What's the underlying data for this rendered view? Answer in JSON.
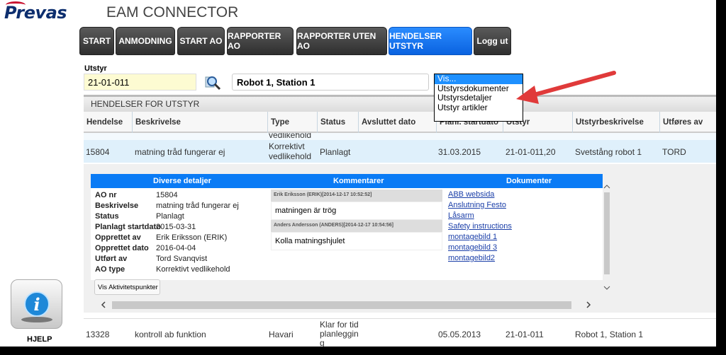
{
  "header": {
    "logo": "Prevas",
    "title": "EAM CONNECTOR"
  },
  "nav": [
    "START",
    "ANMODNING",
    "START AO",
    "RAPPORTER AO",
    "RAPPORTER UTEN AO",
    "HENDELSER UTSTYR",
    "Logg ut"
  ],
  "filter": {
    "label": "Utstyr",
    "value": "21-01-011",
    "description": "Robot 1, Station 1",
    "dropdown": [
      "Vis...",
      "Utstyrsdokumenter",
      "Utstyrsdetaljer",
      "Utstyr artikler"
    ]
  },
  "section_title": "HENDELSER FOR UTSTYR",
  "columns": [
    "Hendelse",
    "Beskrivelse",
    "Type",
    "Status",
    "Avsluttet dato",
    "Planl. startdato",
    "Utstyr",
    "Utstyrbeskrivelse",
    "Utføres av"
  ],
  "partial_row": {
    "type": "vedlikehold"
  },
  "rows": [
    {
      "hendelse": "15804",
      "beskrivelse": "matning tråd fungerar ej",
      "type": "Korrektivt vedlikehold",
      "status": "Planlagt",
      "avsluttet": "",
      "planl": "31.03.2015",
      "utstyr": "21-01-011,20",
      "utstyrbeskrivelse": "Svetstång robot 1",
      "utfores": "TORD"
    },
    {
      "hendelse": "13328",
      "beskrivelse": "kontroll ab funktion",
      "type": "Havari",
      "status": "Klar for tidplanlegging",
      "avsluttet": "",
      "planl": "05.05.2013",
      "utstyr": "21-01-011",
      "utstyrbeskrivelse": "Robot 1, Station 1",
      "utfores": ""
    }
  ],
  "detail": {
    "headers": [
      "Diverse detaljer",
      "Kommentarer",
      "Dokumenter"
    ],
    "fields": [
      {
        "k": "AO nr",
        "v": "15804"
      },
      {
        "k": "Beskrivelse",
        "v": "matning tråd fungerar ej"
      },
      {
        "k": "Status",
        "v": "Planlagt"
      },
      {
        "k": "Planlagt startdato",
        "v": "2015-03-31"
      },
      {
        "k": "Opprettet av",
        "v": "Erik Eriksson (ERIK)"
      },
      {
        "k": "Opprettet dato",
        "v": "2016-04-04"
      },
      {
        "k": "Utført av",
        "v": "Tord Svanqvist"
      },
      {
        "k": "AO type",
        "v": "Korrektivt vedlikehold"
      }
    ],
    "comments": [
      {
        "author": "Erik Eriksson (ERIK)[2014-12-17 10:52:52]",
        "text": "matningen är trög"
      },
      {
        "author": "Anders Andersson (ANDERS)[2014-12-17 10:54:56]",
        "text": "Kolla matningshjulet"
      }
    ],
    "documents": [
      "ABB websida",
      "Anslutning Festo",
      "Låsarm",
      "Safety instructions",
      "montagebild 1",
      "montagebild 3",
      "montagebild2"
    ],
    "button": "Vis Aktivitetspunkter"
  },
  "help": {
    "label": "HJELP"
  },
  "colors": {
    "accent": "#0a7bf5",
    "selected_row": "#dff0fb",
    "arrow": "#e03a3a"
  }
}
